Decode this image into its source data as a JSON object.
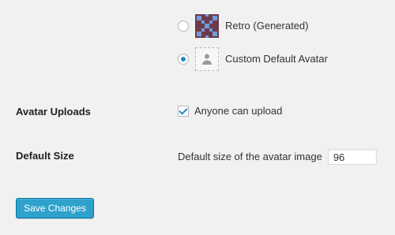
{
  "avatar_options": {
    "retro": {
      "label": "Retro (Generated)",
      "selected": false,
      "icon": "retro-avatar-icon"
    },
    "custom": {
      "label": "Custom Default Avatar",
      "selected": true,
      "icon": "person-silhouette-icon"
    }
  },
  "avatar_uploads": {
    "label": "Avatar Uploads",
    "checkbox_label": "Anyone can upload",
    "checked": true
  },
  "default_size": {
    "label": "Default Size",
    "description": "Default size of the avatar image",
    "value": "96"
  },
  "actions": {
    "save_label": "Save Changes"
  },
  "colors": {
    "accent": "#2ea2cc",
    "accent_border": "#0074a2",
    "checkbox_check": "#1e8cbe",
    "background": "#f1f1f1"
  }
}
